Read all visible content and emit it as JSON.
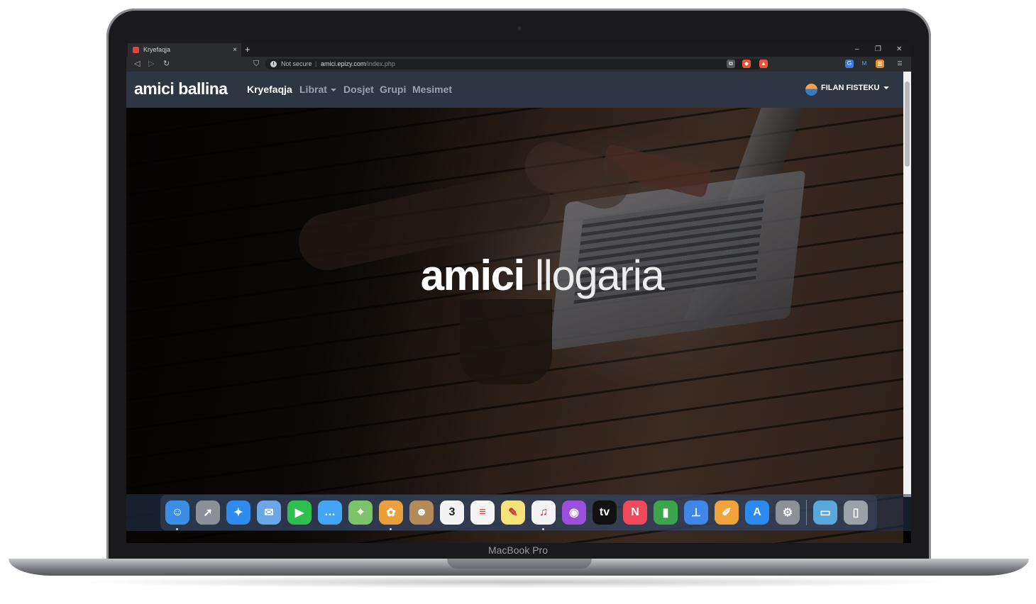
{
  "browser": {
    "tab_title": "Kryefaqja",
    "tab_close": "×",
    "new_tab": "+",
    "window_controls": [
      "–",
      "❐",
      "✕"
    ],
    "security_label": "Not secure",
    "url_host": "amici.epizy.com",
    "url_path": "/index.php",
    "nav_icons": [
      "back-icon",
      "forward-icon",
      "reload-icon",
      "bookmark-icon"
    ]
  },
  "site": {
    "brand": "amici ballina",
    "nav": [
      {
        "label": "Kryefaqja",
        "active": true
      },
      {
        "label": "Librat",
        "dropdown": true
      },
      {
        "label": "Dosjet"
      },
      {
        "label": "Grupi"
      },
      {
        "label": "Mesimet"
      }
    ],
    "user_name": "FILAN FISTEKU"
  },
  "hero": {
    "title_bold": "amici",
    "title_light": "llogaria"
  },
  "device": {
    "label": "MacBook Pro"
  },
  "calendar_day": "3",
  "colors": {
    "navbar": "#2f3643",
    "nav_inactive": "#9aa2ad",
    "browser_chrome": "#2b2c30"
  },
  "dock": [
    {
      "name": "finder-icon",
      "color": "#3a8ee6"
    },
    {
      "name": "launchpad-icon",
      "color": "#8a8f98"
    },
    {
      "name": "safari-icon",
      "color": "#2f8bf0"
    },
    {
      "name": "mail-icon",
      "color": "#6aa7e6"
    },
    {
      "name": "facetime-icon",
      "color": "#2fbf4f"
    },
    {
      "name": "messages-icon",
      "color": "#45a5f5"
    },
    {
      "name": "maps-icon",
      "color": "#7cc36b"
    },
    {
      "name": "photos-icon",
      "color": "#e8a13c"
    },
    {
      "name": "contacts-icon",
      "color": "#b58a5a"
    },
    {
      "name": "calendar-icon",
      "color": "#f3f3f3"
    },
    {
      "name": "reminders-icon",
      "color": "#f5f5f5"
    },
    {
      "name": "notes-icon",
      "color": "#f6e27a"
    },
    {
      "name": "music-icon",
      "color": "#f4f4f6"
    },
    {
      "name": "podcasts-icon",
      "color": "#9b4fdc"
    },
    {
      "name": "appletv-icon",
      "color": "#111111"
    },
    {
      "name": "news-icon",
      "color": "#f24a5a"
    },
    {
      "name": "numbers-icon",
      "color": "#3ca54b"
    },
    {
      "name": "keynote-icon",
      "color": "#3f86e8"
    },
    {
      "name": "pages-icon",
      "color": "#f0a33a"
    },
    {
      "name": "appstore-icon",
      "color": "#2a8af0"
    },
    {
      "name": "system-preferences-icon",
      "color": "#8d9097"
    },
    {
      "name": "downloads-folder-icon",
      "color": "#5aa7d9"
    },
    {
      "name": "trash-icon",
      "color": "#9ba1a9"
    }
  ]
}
